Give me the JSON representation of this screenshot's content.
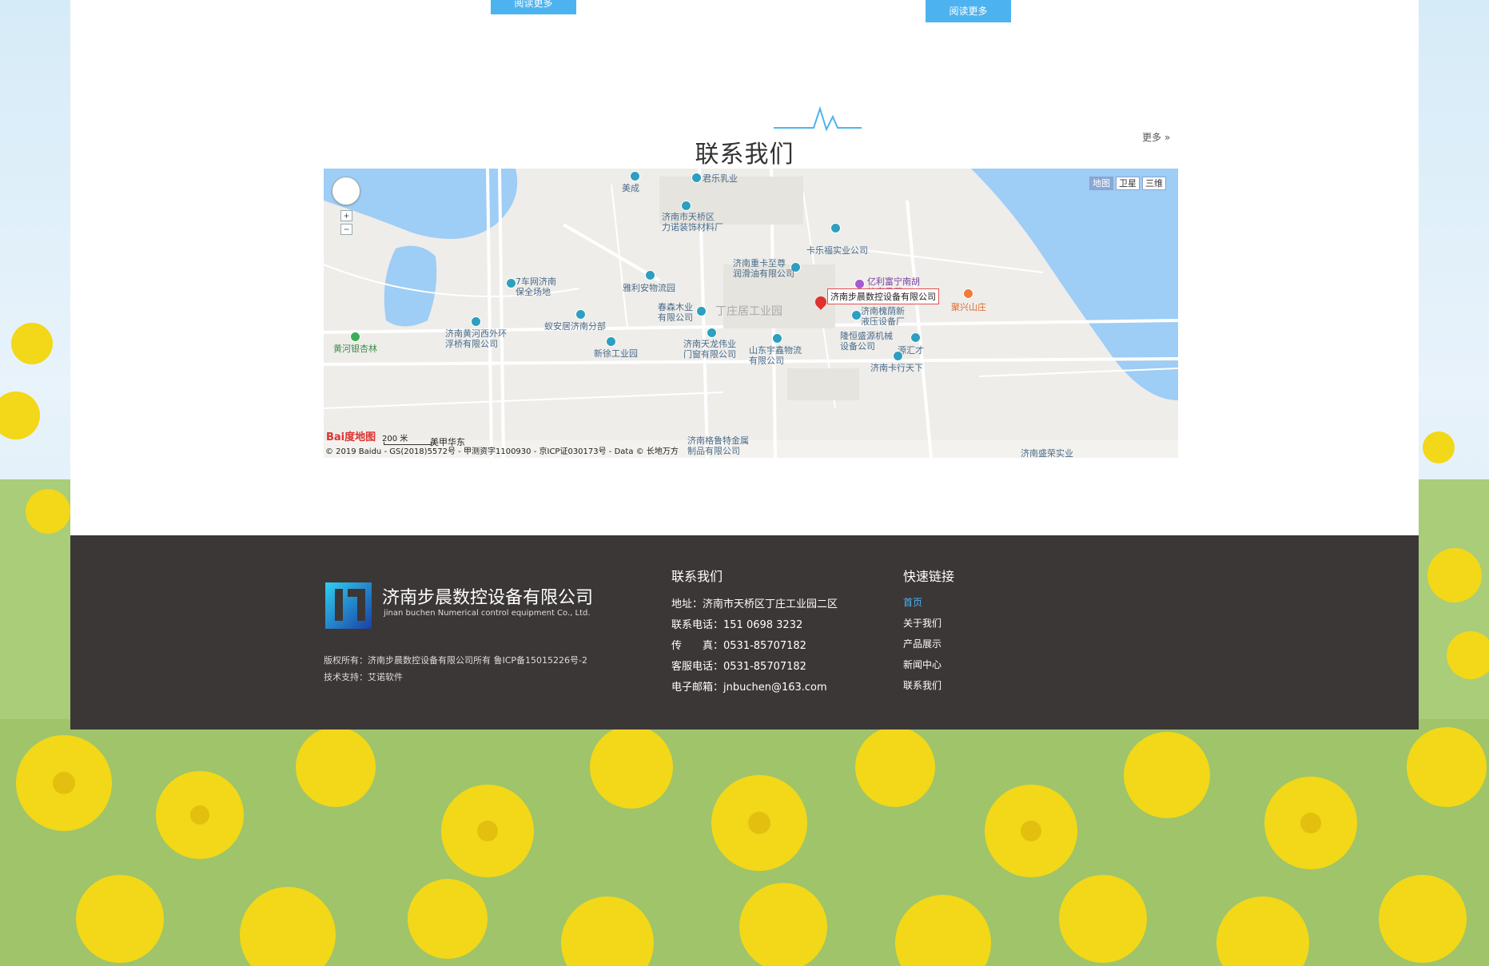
{
  "buttons": {
    "read_more_1": "阅读更多",
    "read_more_2": "阅读更多"
  },
  "contact_section": {
    "title": "联系我们",
    "more_link": "更多 »"
  },
  "map": {
    "map_types": [
      "地图",
      "卫星",
      "三维"
    ],
    "active_type": "地图",
    "zoom_in": "+",
    "zoom_out": "−",
    "marker_label": "济南步晨数控设备有限公司",
    "area_label": "丁庄居工业园",
    "pois": [
      {
        "label": "美成"
      },
      {
        "label": "君乐乳业"
      },
      {
        "label": "济南市天桥区\n力诺装饰材料厂"
      },
      {
        "label": "卡乐福实业公司"
      },
      {
        "label": "济南重卡至尊\n润滑油有限公司"
      },
      {
        "label": "7车网济南\n保全场地"
      },
      {
        "label": "雅利安物流园"
      },
      {
        "label": "亿利富宁南胡\n蚊家具厂"
      },
      {
        "label": "聚兴山庄"
      },
      {
        "label": "春森木业\n有限公司"
      },
      {
        "label": "济南槐荫新\n液压设备厂"
      },
      {
        "label": "蚁安居济南分部"
      },
      {
        "label": "济南黄河西外环\n浮桥有限公司"
      },
      {
        "label": "黄河银杏林"
      },
      {
        "label": "济南天龙伟业\n门窗有限公司"
      },
      {
        "label": "山东宇鑫物流\n有限公司"
      },
      {
        "label": "隆恒盛源机械\n设备公司"
      },
      {
        "label": "源汇才"
      },
      {
        "label": "新徐工业园"
      },
      {
        "label": "济南卡行天下"
      },
      {
        "label": "济南格鲁特金属\n制品有限公司"
      },
      {
        "label": "济南盛荣实业"
      },
      {
        "label": "美甲华东"
      }
    ],
    "scale": "200 米",
    "copyright": "© 2019 Baidu - GS(2018)5572号 - 甲测资字1100930 - 京ICP证030173号 - Data © 长地万方",
    "baidu_logo": "Bai度地图"
  },
  "footer": {
    "company_name": "济南步晨数控设备有限公司",
    "company_en": "jinan buchen Numerical control equipment Co., Ltd.",
    "copyright": "版权所有：济南步晨数控设备有限公司所有 鲁ICP备15015226号-2",
    "tech_support": "技术支持：艾诺软件",
    "contact_title": "联系我们",
    "contact_lines": [
      "地址：济南市天桥区丁庄工业园二区",
      "联系电话：151 0698 3232",
      "传　　真：0531-85707182",
      "客服电话：0531-85707182",
      "电子邮箱：jnbuchen@163.com"
    ],
    "quick_title": "快速链接",
    "quick_links": [
      "首页",
      "关于我们",
      "产品展示",
      "新闻中心",
      "联系我们"
    ],
    "active_link": "首页"
  },
  "colors": {
    "accent": "#4db3f0",
    "footer_bg": "#3b3736",
    "marker": "#e0312f"
  }
}
